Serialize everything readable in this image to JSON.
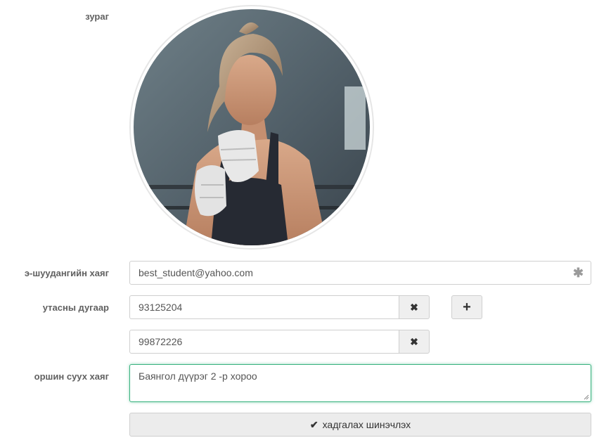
{
  "labels": {
    "photo": "зураг",
    "email": "э-шуудангийн хаяг",
    "phone": "утасны дугаар",
    "address": "оршин суух хаяг"
  },
  "avatar": {
    "icon": "profile-photo"
  },
  "email": {
    "value": "best_student@yahoo.com",
    "required_icon": "asterisk-icon"
  },
  "phones": [
    {
      "value": "93125204",
      "remove_icon": "times-icon"
    },
    {
      "value": "99872226",
      "remove_icon": "times-icon"
    }
  ],
  "add_phone": {
    "icon": "plus-icon"
  },
  "address": {
    "value": "Баянгол дүүрэг 2 -р хороо"
  },
  "save_button": {
    "label": "хадгалах шинэчлэх",
    "icon": "check-icon"
  },
  "colors": {
    "focus": "#39b27f",
    "button_bg": "#efefef"
  }
}
